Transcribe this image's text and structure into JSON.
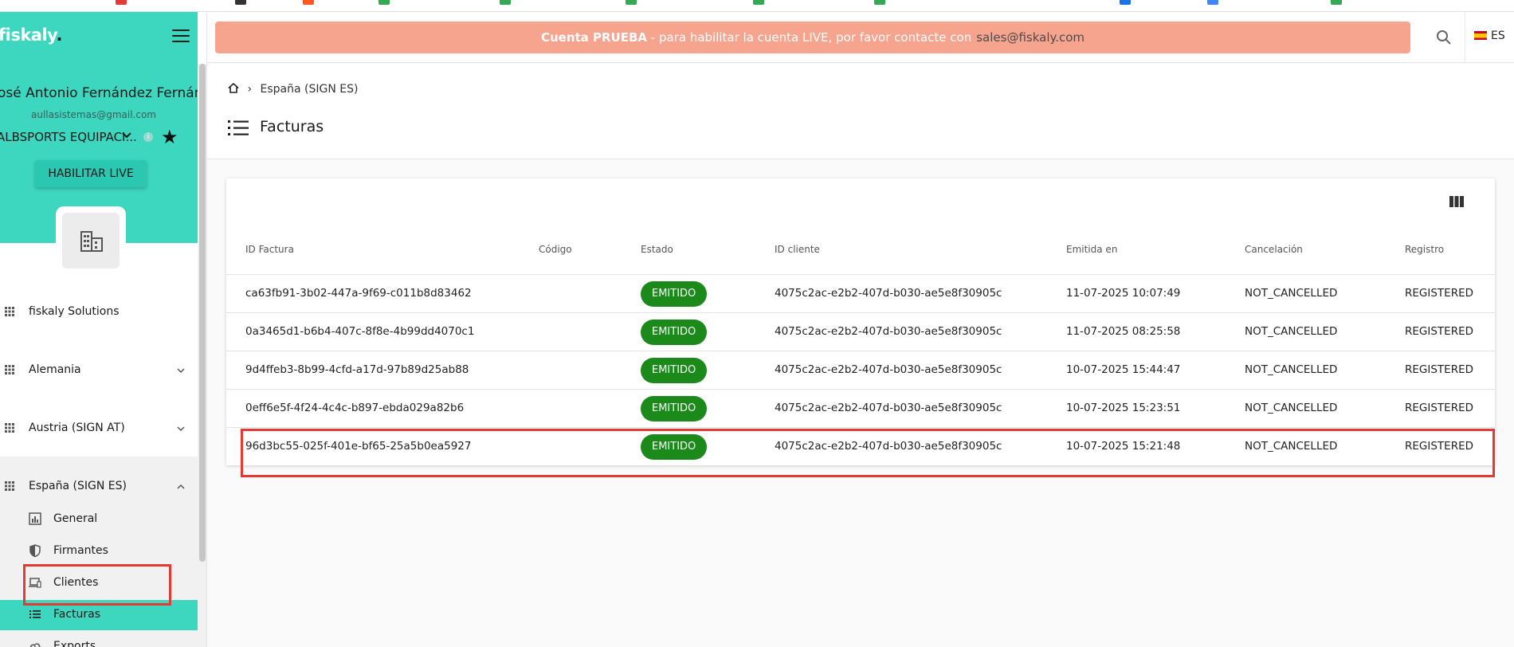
{
  "app": {
    "logo_text": "fiskaly",
    "logo_dot": ".",
    "user_name": "José Antonio Fernández Fernández",
    "user_email": "aullasistemas@gmail.com",
    "org_name": "ALBSPORTS EQUIPACI...",
    "live_button": "HABILITAR LIVE"
  },
  "sidebar": {
    "items": [
      {
        "label": "fiskaly Solutions"
      },
      {
        "label": "Alemania"
      },
      {
        "label": "Austria (SIGN AT)"
      },
      {
        "label": "España (SIGN ES)"
      }
    ],
    "sub_items": [
      {
        "label": "General",
        "icon": "chart-icon"
      },
      {
        "label": "Firmantes",
        "icon": "shield-icon"
      },
      {
        "label": "Clientes",
        "icon": "devices-icon"
      },
      {
        "label": "Facturas",
        "icon": "list-icon",
        "active": true
      },
      {
        "label": "Exports",
        "icon": "cloud-icon"
      }
    ]
  },
  "banner": {
    "bold": "Cuenta PRUEBA",
    "text": " - para habilitar la cuenta LIVE, por favor contacte con",
    "email": "sales@fiskaly.com",
    "color": "#f7a48f"
  },
  "language": {
    "code": "ES"
  },
  "page": {
    "breadcrumb": "España (SIGN ES)",
    "title": "Facturas"
  },
  "table": {
    "headers": [
      "ID Factura",
      "Código",
      "Estado",
      "ID cliente",
      "Emitida en",
      "Cancelación",
      "Registro"
    ],
    "rows": [
      {
        "id": "ca63fb91-3b02-447a-9f69-c011b8d83462",
        "codigo": "",
        "estado": "EMITIDO",
        "cliente": "4075c2ac-e2b2-407d-b030-ae5e8f30905c",
        "emitida": "11-07-2025 10:07:49",
        "cancelacion": "NOT_CANCELLED",
        "registro": "REGISTERED"
      },
      {
        "id": "0a3465d1-b6b4-407c-8f8e-4b99dd4070c1",
        "codigo": "",
        "estado": "EMITIDO",
        "cliente": "4075c2ac-e2b2-407d-b030-ae5e8f30905c",
        "emitida": "11-07-2025 08:25:58",
        "cancelacion": "NOT_CANCELLED",
        "registro": "REGISTERED"
      },
      {
        "id": "9d4ffeb3-8b99-4cfd-a17d-97b89d25ab88",
        "codigo": "",
        "estado": "EMITIDO",
        "cliente": "4075c2ac-e2b2-407d-b030-ae5e8f30905c",
        "emitida": "10-07-2025 15:44:47",
        "cancelacion": "NOT_CANCELLED",
        "registro": "REGISTERED"
      },
      {
        "id": "0eff6e5f-4f24-4c4c-b897-ebda029a82b6",
        "codigo": "",
        "estado": "EMITIDO",
        "cliente": "4075c2ac-e2b2-407d-b030-ae5e8f30905c",
        "emitida": "10-07-2025 15:23:51",
        "cancelacion": "NOT_CANCELLED",
        "registro": "REGISTERED"
      },
      {
        "id": "96d3bc55-025f-401e-bf65-25a5b0ea5927",
        "codigo": "",
        "estado": "EMITIDO",
        "cliente": "4075c2ac-e2b2-407d-b030-ae5e8f30905c",
        "emitida": "10-07-2025 15:21:48",
        "cancelacion": "NOT_CANCELLED",
        "registro": "REGISTERED"
      }
    ]
  },
  "colors": {
    "accent": "#3dd6bf",
    "badge": "#1b8a1b",
    "highlight": "#e53935"
  }
}
